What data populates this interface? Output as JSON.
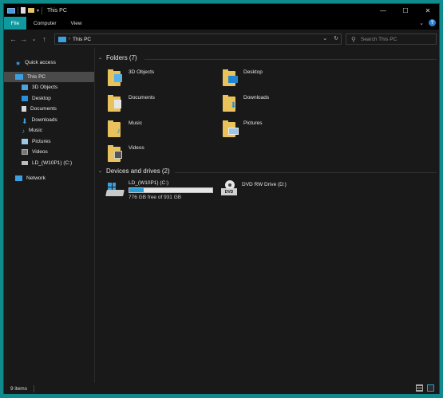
{
  "window": {
    "title": "This PC",
    "controls": {
      "minimize": "—",
      "maximize": "☐",
      "close": "✕"
    }
  },
  "ribbon": {
    "tabs": [
      {
        "label": "File",
        "active": true
      },
      {
        "label": "Computer"
      },
      {
        "label": "View"
      }
    ],
    "expand_icon": "chevron-down-icon",
    "help_label": "?"
  },
  "address": {
    "back": "←",
    "forward": "→",
    "recent": "⌄",
    "up": "↑",
    "path": [
      "This PC"
    ],
    "dropdown": "⌄",
    "refresh": "↻"
  },
  "search": {
    "placeholder": "Search This PC",
    "icon": "search-icon"
  },
  "sidebar": {
    "items": [
      {
        "label": "Quick access",
        "icon": "star-icon",
        "indent": 0
      },
      {
        "label": "This PC",
        "icon": "computer-icon",
        "indent": 0,
        "selected": true
      },
      {
        "label": "3D Objects",
        "icon": "cube-icon",
        "indent": 1
      },
      {
        "label": "Desktop",
        "icon": "desktop-icon",
        "indent": 1
      },
      {
        "label": "Documents",
        "icon": "documents-icon",
        "indent": 1
      },
      {
        "label": "Downloads",
        "icon": "download-icon",
        "indent": 1
      },
      {
        "label": "Music",
        "icon": "music-icon",
        "indent": 1
      },
      {
        "label": "Pictures",
        "icon": "pictures-icon",
        "indent": 1
      },
      {
        "label": "Videos",
        "icon": "videos-icon",
        "indent": 1
      },
      {
        "label": "LD_(W10P1) (C:)",
        "icon": "drive-icon",
        "indent": 1
      },
      {
        "label": "Network",
        "icon": "network-icon",
        "indent": 0
      }
    ]
  },
  "folders": {
    "heading": "Folders (7)",
    "items": [
      {
        "label": "3D Objects",
        "icon": "cube-icon"
      },
      {
        "label": "Desktop",
        "icon": "desktop-icon"
      },
      {
        "label": "Documents",
        "icon": "documents-icon"
      },
      {
        "label": "Downloads",
        "icon": "download-icon"
      },
      {
        "label": "Music",
        "icon": "music-icon"
      },
      {
        "label": "Pictures",
        "icon": "pictures-icon"
      },
      {
        "label": "Videos",
        "icon": "videos-icon"
      }
    ]
  },
  "drives": {
    "heading": "Devices and drives (2)",
    "items": [
      {
        "label": "LD_(W10P1) (C:)",
        "free_text": "776 GB free of 931 GB",
        "used_fraction": 0.17,
        "icon": "windows-drive-icon"
      },
      {
        "label": "DVD RW Drive (D:)",
        "icon": "dvd-drive-icon",
        "badge": "DVD"
      }
    ]
  },
  "status": {
    "items_text": "9 items"
  },
  "colors": {
    "accent": "#0f9aa0",
    "selection": "#4a4a4a",
    "folder": "#e9c25b",
    "drive_fill": "#26a0da",
    "background": "#191919"
  }
}
